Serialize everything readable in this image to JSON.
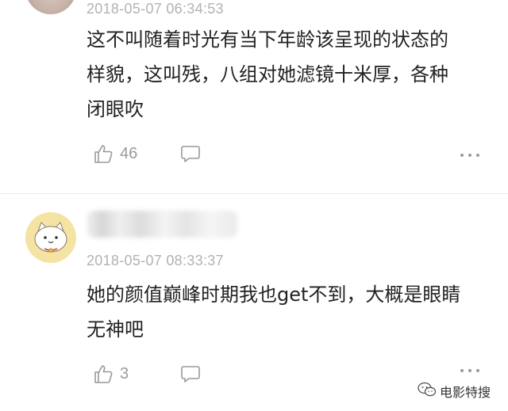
{
  "comments": [
    {
      "timestamp": "2018-05-07 06:34:53",
      "text_lines": [
        "这不叫随着时光有当下年龄该呈现的状态的",
        "样貌，这叫残，八组对她滤镜十米厚，各种",
        "闭眼吹"
      ],
      "likes": "46",
      "avatar": "user-avatar-photo"
    },
    {
      "timestamp": "2018-05-07 08:33:37",
      "text_lines": [
        "她的颜值巅峰时期我也get不到，大概是眼睛",
        "无神吧"
      ],
      "likes": "3",
      "avatar": "cat-avatar"
    }
  ],
  "icons": {
    "like": "thumbs-up-icon",
    "reply": "comment-bubble-icon",
    "more": "more-dots-icon",
    "watermark": "wechat-icon"
  },
  "watermark": {
    "label": "电影特搜"
  },
  "colors": {
    "text": "#222222",
    "meta": "#b2b2b2",
    "icon": "#9a9a9a",
    "divider": "#ececec"
  }
}
